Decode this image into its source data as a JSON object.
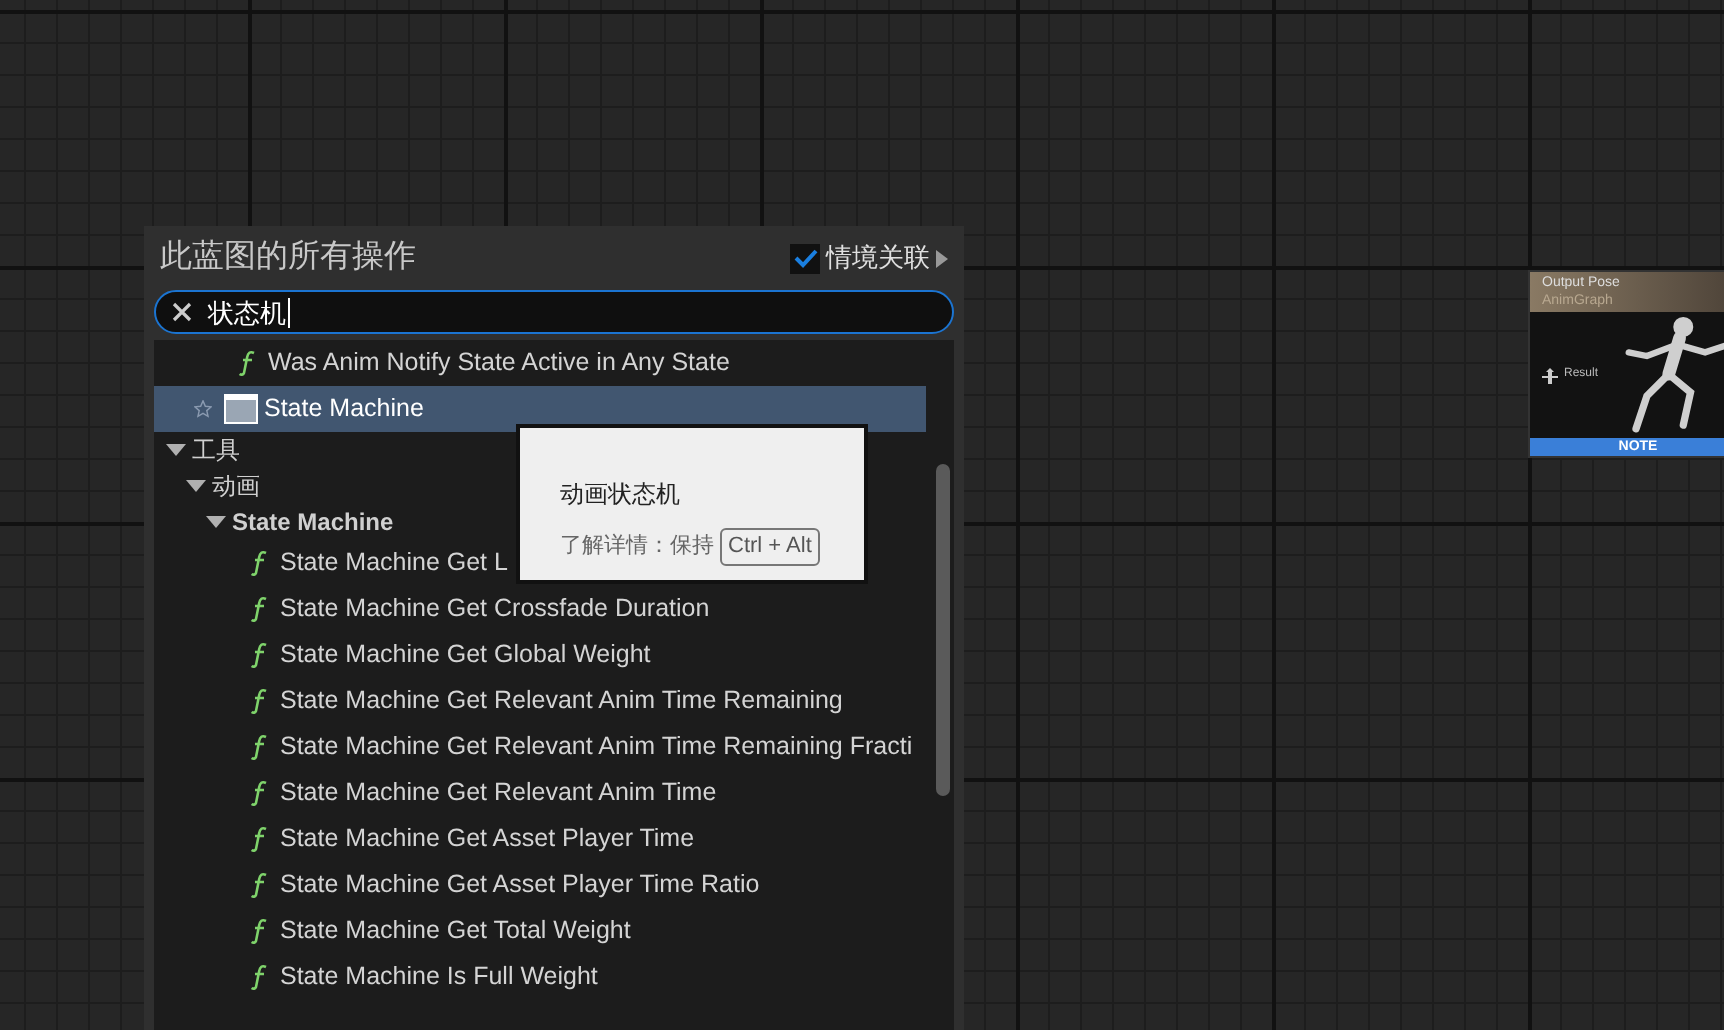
{
  "panel": {
    "title": "此蓝图的所有操作",
    "context_toggle": {
      "label": "情境关联",
      "checked": true
    },
    "search": {
      "value": "状态机"
    },
    "items": [
      {
        "kind": "function",
        "label": "Was Anim Notify State Active in Any State",
        "selected": false
      },
      {
        "kind": "node",
        "label": "State Machine",
        "selected": true
      },
      {
        "kind": "category",
        "label": "工具",
        "expanded": true,
        "children": [
          {
            "kind": "category",
            "label": "动画",
            "expanded": true,
            "children": [
              {
                "kind": "category",
                "label": "State Machine",
                "expanded": true,
                "children": [
                  {
                    "kind": "function",
                    "label": "State Machine Get L",
                    "selected": false
                  },
                  {
                    "kind": "function",
                    "label": "State Machine Get Crossfade Duration",
                    "selected": false
                  },
                  {
                    "kind": "function",
                    "label": "State Machine Get Global Weight",
                    "selected": false
                  },
                  {
                    "kind": "function",
                    "label": "State Machine Get Relevant Anim Time Remaining",
                    "selected": false
                  },
                  {
                    "kind": "function",
                    "label": "State Machine Get Relevant Anim Time Remaining Fracti",
                    "selected": false
                  },
                  {
                    "kind": "function",
                    "label": "State Machine Get Relevant Anim Time",
                    "selected": false
                  },
                  {
                    "kind": "function",
                    "label": "State Machine Get Asset Player Time",
                    "selected": false
                  },
                  {
                    "kind": "function",
                    "label": "State Machine Get Asset Player Time Ratio",
                    "selected": false
                  },
                  {
                    "kind": "function",
                    "label": "State Machine Get Total Weight",
                    "selected": false
                  },
                  {
                    "kind": "function",
                    "label": "State Machine Is Full Weight",
                    "selected": false
                  }
                ]
              }
            ]
          }
        ]
      }
    ]
  },
  "tooltip": {
    "title": "动画状态机",
    "hint": "了解详情：保持",
    "shortcut": "Ctrl + Alt"
  },
  "node": {
    "title": "Output Pose",
    "subtitle": "AnimGraph",
    "pin": "Result",
    "footer": "NOTE"
  }
}
